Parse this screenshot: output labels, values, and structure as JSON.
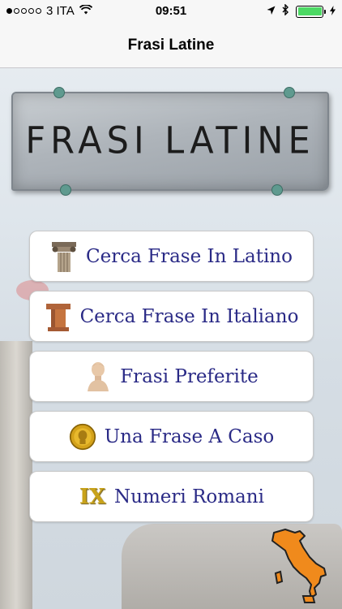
{
  "status_bar": {
    "carrier": "3 ITA",
    "time": "09:51"
  },
  "nav": {
    "title": "Frasi Latine"
  },
  "banner": {
    "title": "FRASI LATINE"
  },
  "menu": [
    {
      "label": "Cerca Frase In Latino",
      "icon": "column-capital-icon"
    },
    {
      "label": "Cerca Frase In Italiano",
      "icon": "wooden-pedestal-icon"
    },
    {
      "label": "Frasi Preferite",
      "icon": "bust-icon"
    },
    {
      "label": "Una Frase A Caso",
      "icon": "gold-coin-icon"
    },
    {
      "label": "Numeri Romani",
      "icon": "roman-numeral-icon",
      "icon_text": "IX"
    }
  ],
  "colors": {
    "menu_text": "#2a2a86",
    "battery": "#4cd964",
    "italy_map": "#f08a1c"
  }
}
